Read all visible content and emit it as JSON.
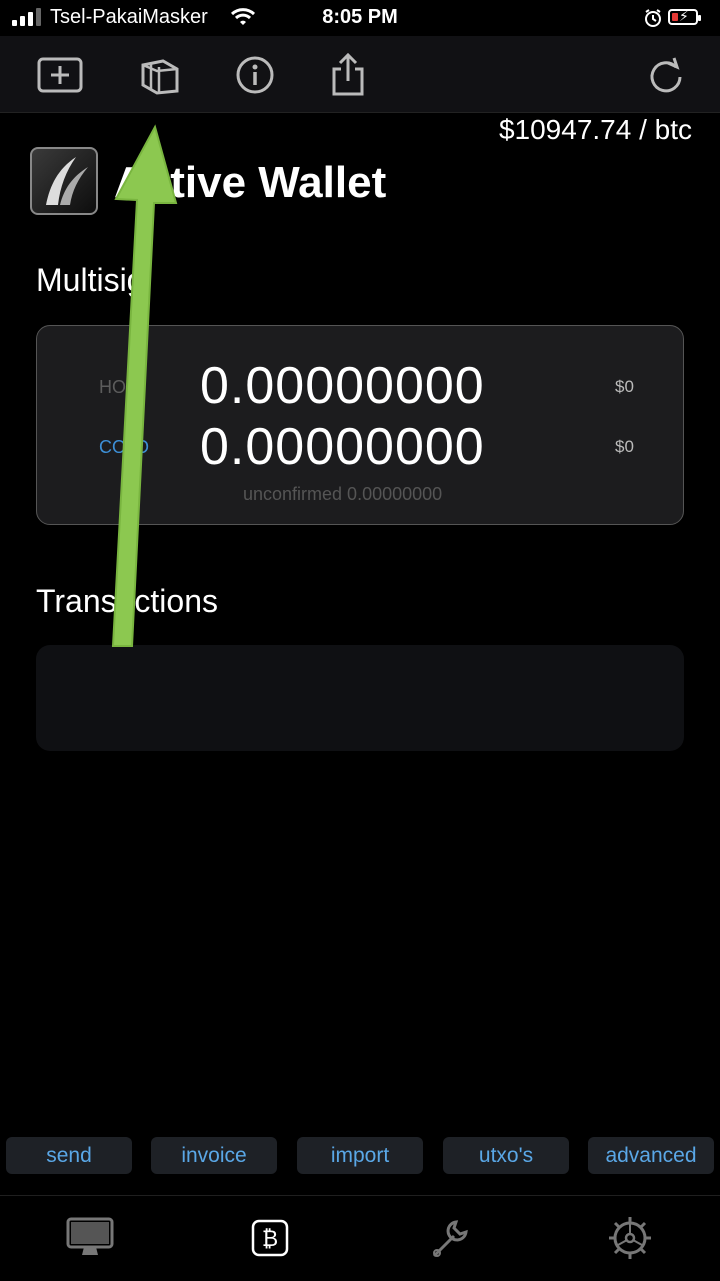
{
  "status_bar": {
    "carrier": "Tsel-PakaiMasker",
    "time": "8:05 PM"
  },
  "toolbar": {
    "icons": [
      "add-icon",
      "wallets-icon",
      "info-icon",
      "share-icon",
      "refresh-icon"
    ]
  },
  "price": "$10947.74 / btc",
  "wallet": {
    "title": "Active Wallet",
    "type_label": "Multisig"
  },
  "balance": {
    "hot_label": "HOT",
    "hot_amount": "0.00000000",
    "hot_fiat": "$0",
    "cold_label": "COLD",
    "cold_amount": "0.00000000",
    "cold_fiat": "$0",
    "unconfirmed": "unconfirmed 0.00000000"
  },
  "transactions": {
    "title": "Transactions"
  },
  "actions": [
    "send",
    "invoice",
    "import",
    "utxo's",
    "advanced"
  ],
  "tabbar": {
    "tabs": [
      "monitor-icon",
      "bitcoin-icon",
      "wrench-icon",
      "settings-gear-icon"
    ]
  },
  "colors": {
    "background": "#000000",
    "accent": "#5aa7e6",
    "card": "#1c1c1e",
    "arrow": "#8cc850"
  }
}
